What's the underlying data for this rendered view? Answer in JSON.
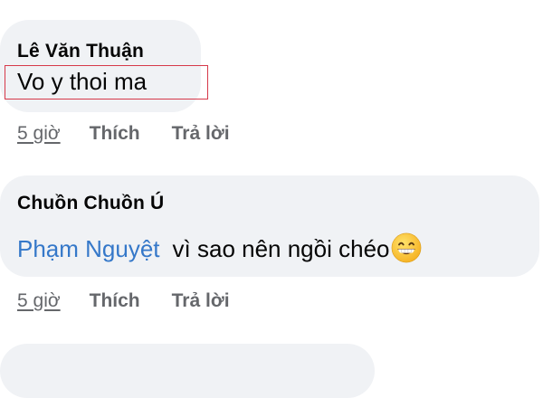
{
  "comments": [
    {
      "author": "Lê Văn Thuận",
      "text": "Vo y thoi ma",
      "time": "5 giờ",
      "like_label": "Thích",
      "reply_label": "Trả lời"
    },
    {
      "author": "Chuồn Chuồn Ú",
      "mention": "Phạm Nguyệt",
      "text": "vì sao nên ngồi chéo",
      "emoji": "grinning-face-icon",
      "time": "5 giờ",
      "like_label": "Thích",
      "reply_label": "Trả lời"
    }
  ],
  "colors": {
    "bubble": "#f0f2f5",
    "mention": "#3578c9",
    "secondary_text": "#65676b",
    "highlight_border": "#d6394a"
  }
}
